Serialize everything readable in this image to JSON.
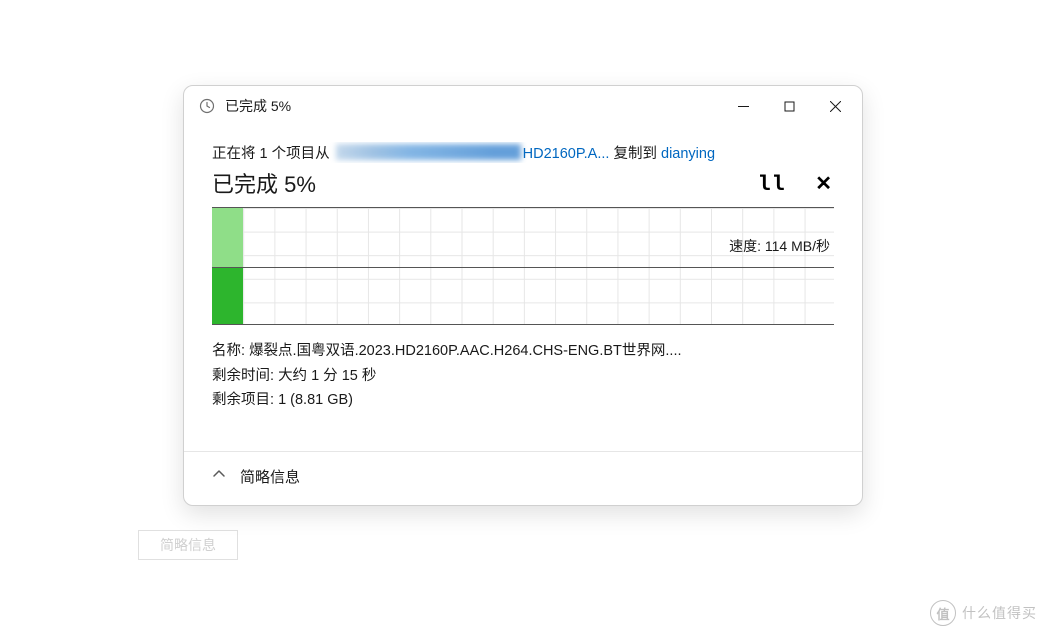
{
  "window": {
    "title": "已完成 5%"
  },
  "copy": {
    "prefix": "正在将 1 个项目从 ",
    "source_visible": "HD2160P.A...",
    "middle": " 复制到 ",
    "dest": "dianying"
  },
  "progress": {
    "label": "已完成 5%",
    "percent": 5
  },
  "graph": {
    "speed_label": "速度: 114 MB/秒"
  },
  "details": {
    "name_label": "名称: ",
    "name_value": "爆裂点.国粤双语.2023.HD2160P.AAC.H264.CHS-ENG.BT世界网....",
    "time_label": "剩余时间: ",
    "time_value": "大约 1 分 15 秒",
    "items_label": "剩余项目: ",
    "items_value": "1 (8.81 GB)"
  },
  "footer": {
    "toggle_label": "简略信息"
  },
  "shadow": {
    "label": "简略信息"
  },
  "watermark": {
    "icon": "值",
    "text": "什么值得买"
  }
}
